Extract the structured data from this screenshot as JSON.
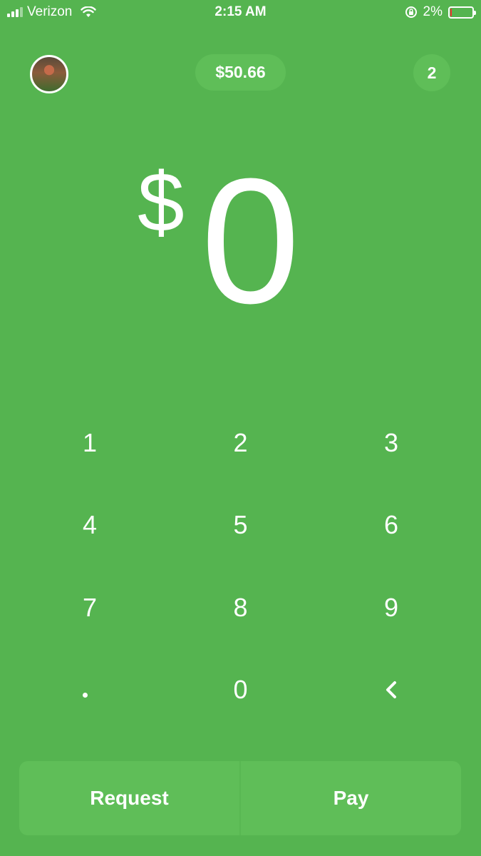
{
  "status_bar": {
    "carrier": "Verizon",
    "time": "2:15 AM",
    "battery_percent": "2%"
  },
  "header": {
    "balance": "$50.66",
    "notification_count": "2"
  },
  "amount": {
    "currency_symbol": "$",
    "value": "0"
  },
  "keypad": {
    "k1": "1",
    "k2": "2",
    "k3": "3",
    "k4": "4",
    "k5": "5",
    "k6": "6",
    "k7": "7",
    "k8": "8",
    "k9": "9",
    "k0": "0"
  },
  "actions": {
    "request_label": "Request",
    "pay_label": "Pay"
  },
  "colors": {
    "background": "#55b450",
    "pill": "#5fbe58",
    "text": "#ffffff"
  }
}
